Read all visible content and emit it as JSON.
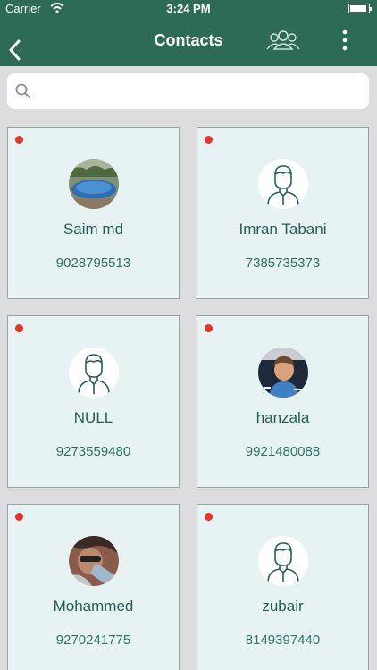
{
  "status_bar": {
    "carrier": "Carrier",
    "time": "3:24 PM",
    "battery_level": 0.9
  },
  "nav": {
    "title": "Contacts",
    "icons": [
      "back-chevron-icon",
      "group-icon",
      "more-vertical-icon"
    ]
  },
  "search": {
    "placeholder": "",
    "value": ""
  },
  "colors": {
    "header": "#2d6b57",
    "card_bg": "#e6f3f2",
    "text": "#245f57",
    "status_dot": "#e8322a"
  },
  "contacts": [
    {
      "name": "Saim md",
      "phone": "9028795513",
      "avatar": "pool-photo"
    },
    {
      "name": "Imran Tabani",
      "phone": "7385735373",
      "avatar": "person-icon"
    },
    {
      "name": "NULL",
      "phone": "9273559480",
      "avatar": "person-icon"
    },
    {
      "name": "hanzala",
      "phone": "9921480088",
      "avatar": "person-photo"
    },
    {
      "name": "Mohammed",
      "phone": "9270241775",
      "avatar": "selfie-photo"
    },
    {
      "name": "zubair",
      "phone": "8149397440",
      "avatar": "person-icon"
    }
  ]
}
